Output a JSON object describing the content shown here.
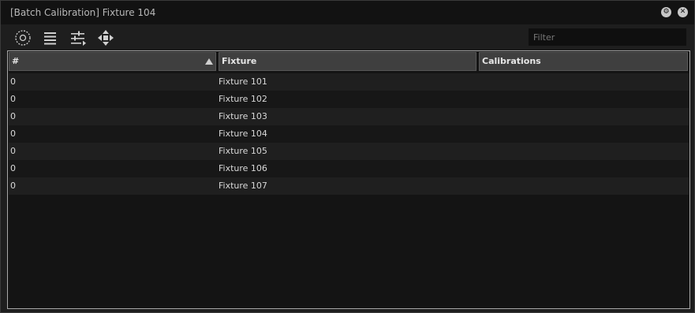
{
  "window": {
    "title": "[Batch Calibration] Fixture 104"
  },
  "toolbar": {
    "tools": [
      "target-icon",
      "list-icon",
      "sliders-icon",
      "move-icon"
    ],
    "filter_placeholder": "Filter"
  },
  "table": {
    "columns": [
      "#",
      "Fixture",
      "Calibrations"
    ],
    "sort_column": "#",
    "sort_direction": "ascending",
    "rows": [
      {
        "num": "0",
        "fixture": "Fixture 101",
        "calibrations": ""
      },
      {
        "num": "0",
        "fixture": "Fixture 102",
        "calibrations": ""
      },
      {
        "num": "0",
        "fixture": "Fixture 103",
        "calibrations": ""
      },
      {
        "num": "0",
        "fixture": "Fixture 104",
        "calibrations": ""
      },
      {
        "num": "0",
        "fixture": "Fixture 105",
        "calibrations": ""
      },
      {
        "num": "0",
        "fixture": "Fixture 106",
        "calibrations": ""
      },
      {
        "num": "0",
        "fixture": "Fixture 107",
        "calibrations": ""
      }
    ]
  }
}
